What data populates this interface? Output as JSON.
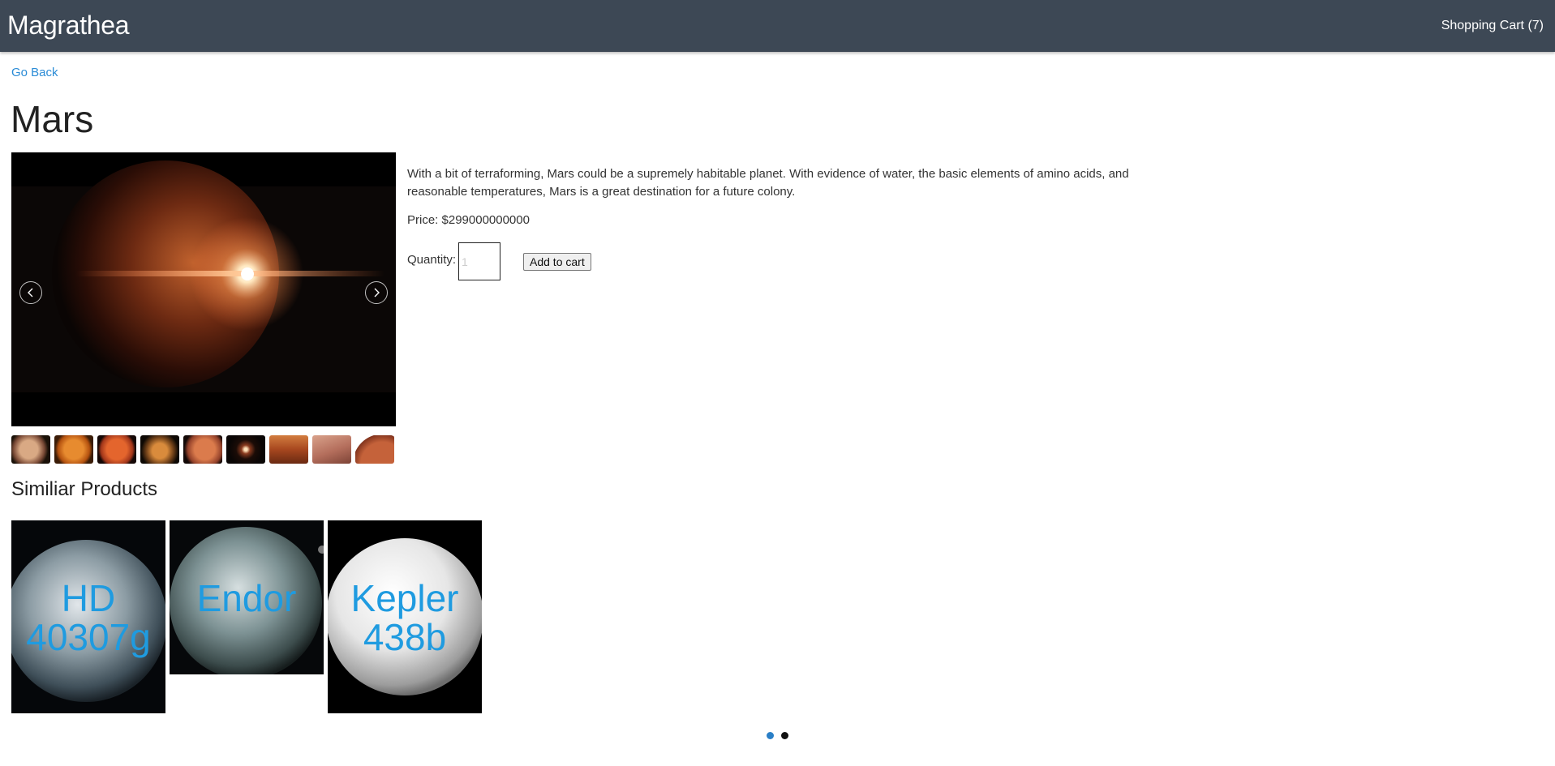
{
  "header": {
    "brand": "Magrathea",
    "cart_label": "Shopping Cart (7)"
  },
  "nav": {
    "go_back": "Go Back"
  },
  "product": {
    "name": "Mars",
    "description": "With a bit of terraforming, Mars could be a supremely habitable planet. With evidence of water, the basic elements of amino acids, and reasonable temperatures, Mars is a great destination for a future colony.",
    "price_text": "Price: $299000000000",
    "quantity_label": "Quantity:",
    "quantity_placeholder": "1",
    "add_to_cart": "Add to cart",
    "gallery": {
      "prev_icon": "chevron-left-icon",
      "next_icon": "chevron-right-icon",
      "thumbnail_count": 9,
      "active_thumbnail": 6
    }
  },
  "similar": {
    "title": "Similiar Products",
    "items": [
      {
        "name": "HD 40307g"
      },
      {
        "name": "Endor"
      },
      {
        "name": "Kepler 438b"
      }
    ],
    "pager": {
      "pages": 2,
      "active": 1
    }
  },
  "colors": {
    "header_bg": "#3d4855",
    "link": "#2a8bd6",
    "card_label": "#1f9be0",
    "dot_active": "#2a7fc7",
    "dot_inactive": "#111111"
  }
}
